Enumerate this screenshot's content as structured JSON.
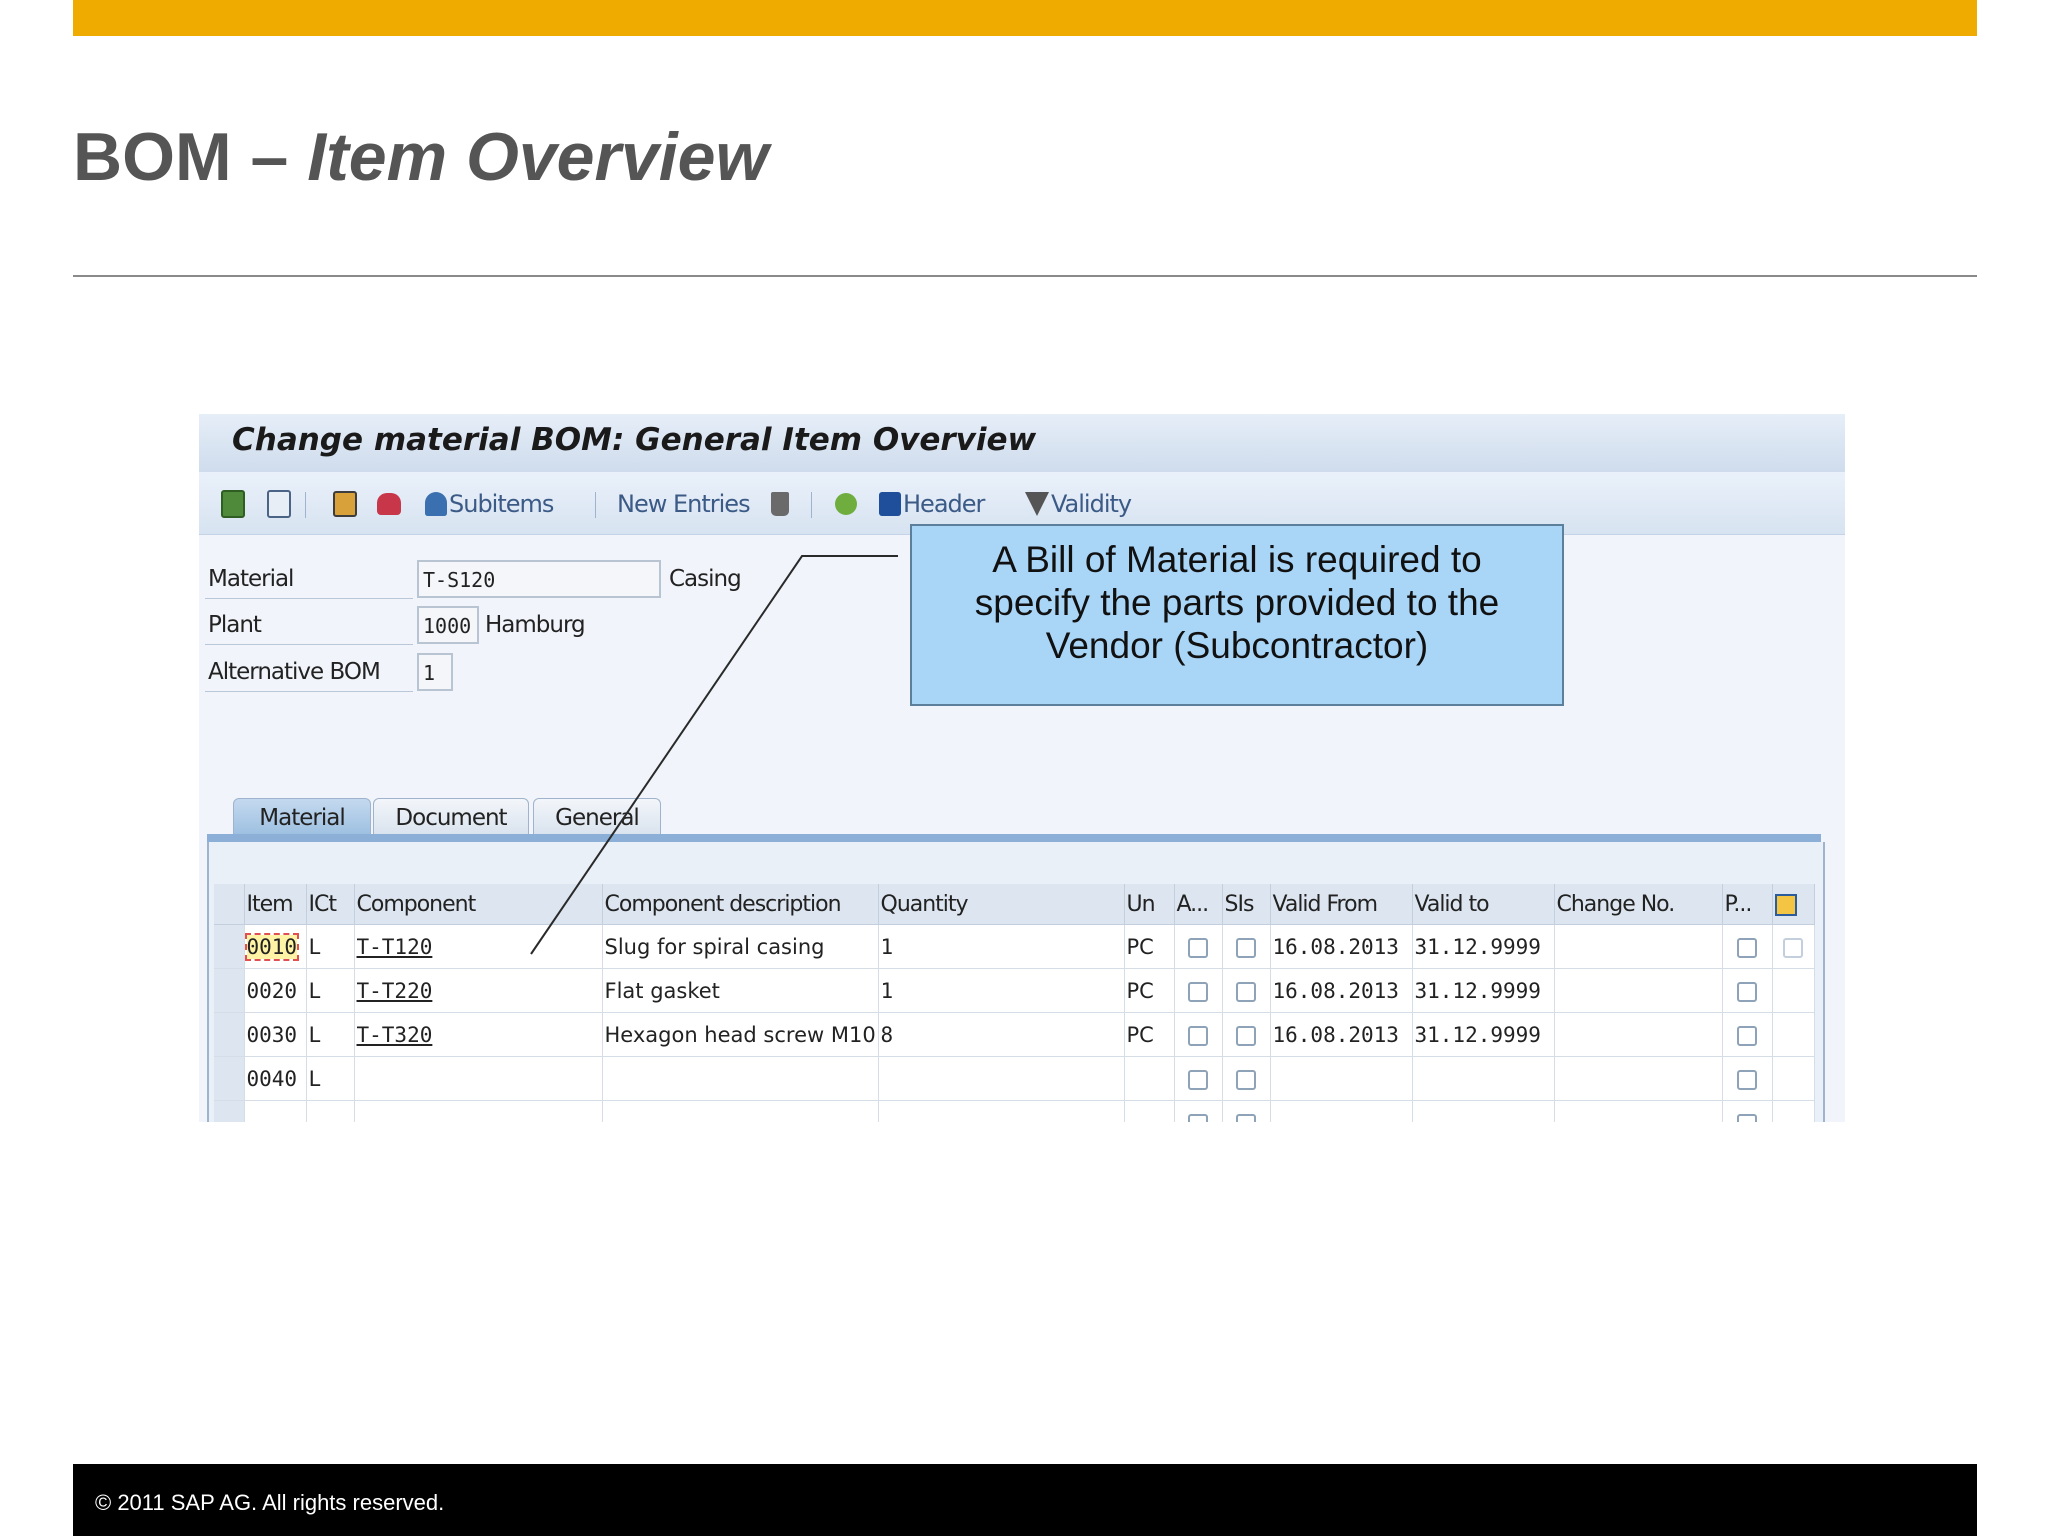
{
  "slide": {
    "title_main": "BOM – ",
    "title_italic": "Item Overview",
    "footer": "©  2011 SAP AG. All rights reserved."
  },
  "colors": {
    "accent_bar": "#f0ab00",
    "callout_bg": "#a9d5f7",
    "footer_bg": "#000000"
  },
  "sap": {
    "window_title": "Change material BOM: General Item Overview",
    "toolbar": {
      "subitems_label": "Subitems",
      "new_entries_label": "New Entries",
      "header_label": "Header",
      "validity_label": "Validity",
      "icons": [
        "first-page-icon",
        "next-page-icon",
        "item-detail-icon",
        "print-icon",
        "subitems-icon",
        "delete-icon",
        "change-icon",
        "header-info-icon",
        "validity-filter-icon"
      ]
    },
    "fields": {
      "material_label": "Material",
      "material_value": "T-S120",
      "material_desc": "Casing",
      "plant_label": "Plant",
      "plant_value": "1000",
      "plant_desc": "Hamburg",
      "altbom_label": "Alternative BOM",
      "altbom_value": "1"
    },
    "callout": {
      "line1": "A Bill of Material is required to",
      "line2": "specify the parts provided to the",
      "line3": "Vendor (Subcontractor)"
    },
    "tabs": [
      "Material",
      "Document",
      "General"
    ],
    "table": {
      "columns": [
        "Item",
        "ICt",
        "Component",
        "Component description",
        "Quantity",
        "Un",
        "A...",
        "SIs",
        "Valid From",
        "Valid to",
        "Change No.",
        "P..."
      ],
      "rows": [
        {
          "item": "0010",
          "ict": "L",
          "component": "T-T120",
          "description": "Slug for spiral casing",
          "quantity": "1",
          "un": "PC",
          "valid_from": "16.08.2013",
          "valid_to": "31.12.9999"
        },
        {
          "item": "0020",
          "ict": "L",
          "component": "T-T220",
          "description": "Flat gasket",
          "quantity": "1",
          "un": "PC",
          "valid_from": "16.08.2013",
          "valid_to": "31.12.9999"
        },
        {
          "item": "0030",
          "ict": "L",
          "component": "T-T320",
          "description": "Hexagon head screw M10",
          "quantity": "8",
          "un": "PC",
          "valid_from": "16.08.2013",
          "valid_to": "31.12.9999"
        },
        {
          "item": "0040",
          "ict": "L",
          "component": "",
          "description": "",
          "quantity": "",
          "un": "",
          "valid_from": "",
          "valid_to": ""
        }
      ]
    }
  }
}
